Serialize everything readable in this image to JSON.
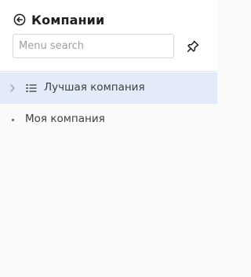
{
  "header": {
    "title": "Компании",
    "back_icon": "arrow-left-circle-icon"
  },
  "search": {
    "placeholder": "Menu search",
    "value": ""
  },
  "pin": {
    "icon": "pin-icon"
  },
  "tree": {
    "items": [
      {
        "label": "Лучшая компания",
        "expand_icon": "chevron-right-icon",
        "type_icon": "list-icon",
        "selected": true
      },
      {
        "label": "Моя компания",
        "bullet_icon": "dot-icon",
        "selected": false
      }
    ]
  },
  "colors": {
    "selected_row": "#e3ebf8",
    "panel_bg": "#fafafa",
    "header_bg": "#ffffff"
  }
}
